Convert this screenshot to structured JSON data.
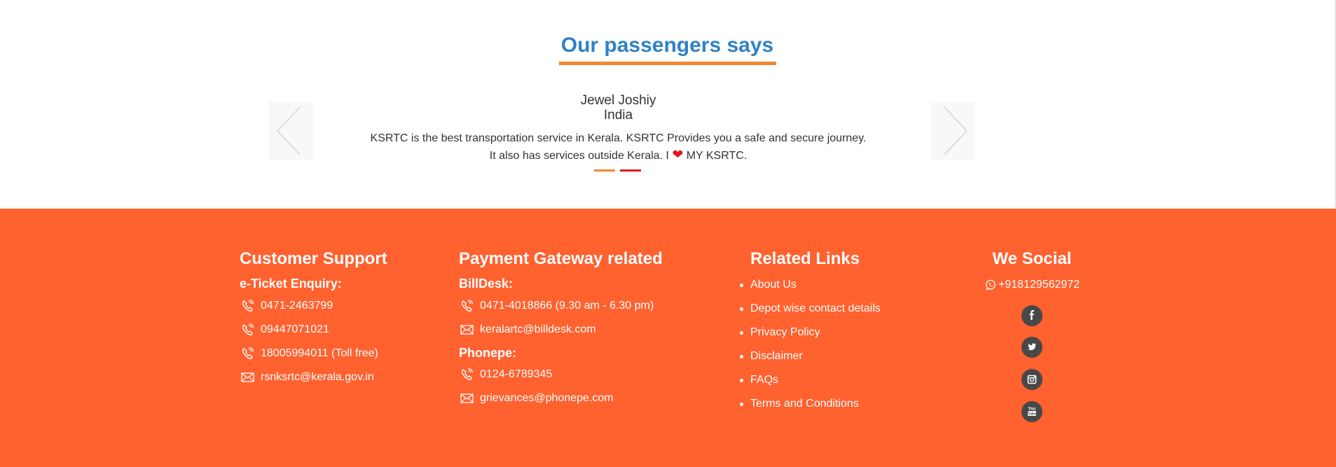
{
  "testimonials": {
    "heading": "Our passengers says",
    "name": "Jewel Joshiy",
    "country": "India",
    "quote_line1": "KSRTC is the best transportation service in Kerala. KSRTC Provides you a safe and secure journey.",
    "quote_line2_before": "It also has services outside Kerala. I",
    "quote_line2_after": "MY KSRTC.",
    "heart_icon": "heart-icon",
    "dot_colors": [
      "#f2872f",
      "#e0181b"
    ]
  },
  "footer": {
    "background": "#ff612f",
    "customer_support": {
      "title": "Customer Support",
      "subtitle": "e-Ticket Enquiry:",
      "items": [
        {
          "icon": "phone-icon",
          "text": "0471-2463799"
        },
        {
          "icon": "phone-icon",
          "text": "09447071021"
        },
        {
          "icon": "phone-icon",
          "text": "18005994011 (Toll free)"
        },
        {
          "icon": "mail-icon",
          "text": "rsnksrtc@kerala.gov.in"
        }
      ]
    },
    "payment": {
      "title": "Payment Gateway related",
      "billdesk": {
        "label": "BillDesk:",
        "items": [
          {
            "icon": "phone-icon",
            "text": "0471-4018866 (9.30 am - 6.30 pm)"
          },
          {
            "icon": "mail-icon",
            "text": "keralartc@billdesk.com"
          }
        ]
      },
      "phonepe": {
        "label": "Phonepe:",
        "items": [
          {
            "icon": "phone-icon",
            "text": "0124-6789345"
          },
          {
            "icon": "mail-icon",
            "text": "grievances@phonepe.com"
          }
        ]
      }
    },
    "related_links": {
      "title": "Related Links",
      "items": [
        "About Us",
        "Depot wise contact details",
        "Privacy Policy",
        "Disclaimer",
        "FAQs",
        "Terms and Conditions"
      ]
    },
    "social": {
      "title": "We Social",
      "whatsapp": "+918129562972",
      "icons": [
        "facebook-icon",
        "twitter-icon",
        "instagram-icon",
        "youtube-icon"
      ]
    }
  }
}
